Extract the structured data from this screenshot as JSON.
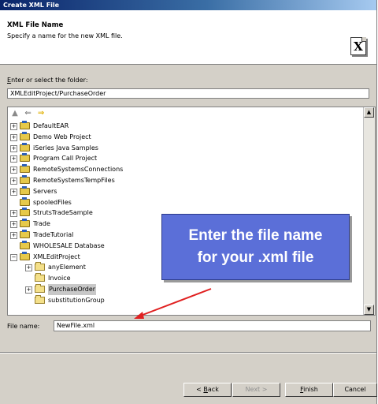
{
  "window": {
    "title": "Create XML File"
  },
  "header": {
    "title": "XML File Name",
    "subtitle": "Specify a name for the new XML file.",
    "icon_letter": "X",
    "icon_name": "xml-file-icon"
  },
  "folder": {
    "label": "Enter or select the folder:",
    "value": "XMLEditProject/PurchaseOrder"
  },
  "tree": {
    "toolbar": [
      "home-icon",
      "back-arrow-icon",
      "forward-arrow-icon"
    ],
    "items": [
      {
        "label": "DefaultEAR",
        "level": 0,
        "expander": "+",
        "icon": "project"
      },
      {
        "label": "Demo Web Project",
        "level": 0,
        "expander": "+",
        "icon": "project"
      },
      {
        "label": "iSeries Java Samples",
        "level": 0,
        "expander": "+",
        "icon": "project"
      },
      {
        "label": "Program Call Project",
        "level": 0,
        "expander": "+",
        "icon": "project"
      },
      {
        "label": "RemoteSystemsConnections",
        "level": 0,
        "expander": "+",
        "icon": "project"
      },
      {
        "label": "RemoteSystemsTempFiles",
        "level": 0,
        "expander": "+",
        "icon": "project"
      },
      {
        "label": "Servers",
        "level": 0,
        "expander": "+",
        "icon": "project"
      },
      {
        "label": "spooledFiles",
        "level": 0,
        "expander": "",
        "icon": "project"
      },
      {
        "label": "StrutsTradeSample",
        "level": 0,
        "expander": "+",
        "icon": "project"
      },
      {
        "label": "Trade",
        "level": 0,
        "expander": "+",
        "icon": "project"
      },
      {
        "label": "TradeTutorial",
        "level": 0,
        "expander": "+",
        "icon": "project"
      },
      {
        "label": "WHOLESALE Database",
        "level": 0,
        "expander": "",
        "icon": "project"
      },
      {
        "label": "XMLEditProject",
        "level": 0,
        "expander": "-",
        "icon": "project"
      },
      {
        "label": "anyElement",
        "level": 1,
        "expander": "+",
        "icon": "folder"
      },
      {
        "label": "Invoice",
        "level": 1,
        "expander": "",
        "icon": "folder"
      },
      {
        "label": "PurchaseOrder",
        "level": 1,
        "expander": "+",
        "icon": "folder",
        "selected": true
      },
      {
        "label": "substitutionGroup",
        "level": 1,
        "expander": "",
        "icon": "folder"
      }
    ]
  },
  "callout": {
    "line1": "Enter the file name",
    "line2": "for your .xml file"
  },
  "filename": {
    "label": "File name:",
    "value": "NewFile.xml"
  },
  "buttons": {
    "back": {
      "label_pre": "< ",
      "label_u": "B",
      "label_post": "ack",
      "enabled": true
    },
    "next": {
      "label": "Next >",
      "enabled": false
    },
    "finish": {
      "label_u": "F",
      "label_post": "inish",
      "enabled": true
    },
    "cancel": {
      "label": "Cancel",
      "enabled": true
    }
  },
  "colors": {
    "callout_bg": "#5b6fd8",
    "arrow": "#e02020",
    "title_bar": "#0a246a"
  }
}
